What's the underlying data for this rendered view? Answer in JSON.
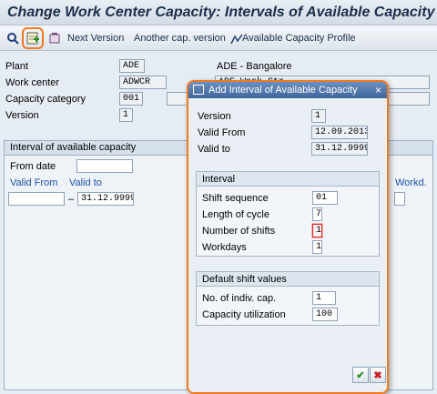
{
  "title": "Change Work Center Capacity: Intervals of Available Capacity",
  "toolbar": {
    "next_version": "Next Version",
    "another_version": "Another cap. version",
    "available_capacity_profile": "Available Capacity Profile"
  },
  "header": {
    "plant_label": "Plant",
    "plant_value": "ADE",
    "plant_desc": "ADE - Bangalore",
    "work_center_label": "Work center",
    "work_center_value": "ADWCR",
    "work_center_desc": "ADE Work Ctr",
    "capacity_category_label": "Capacity category",
    "capacity_category_value": "001",
    "version_label": "Version",
    "version_value": "1"
  },
  "interval_group": {
    "title": "Interval of available capacity",
    "from_date_label": "From date",
    "valid_from_col": "Valid From",
    "valid_to_col": "Valid to",
    "workdays_col": "Workd.",
    "row_valid_from": "",
    "row_dash": "–",
    "row_valid_to": "31.12.9999"
  },
  "dialog": {
    "title": "Add Interval of Available Capacity",
    "close": "×",
    "version_label": "Version",
    "version_value": "1",
    "valid_from_label": "Valid From",
    "valid_from_value": "12.09.2013",
    "valid_to_label": "Valid to",
    "valid_to_value": "31.12.9999",
    "interval_head": "Interval",
    "shift_sequence_label": "Shift sequence",
    "shift_sequence_value": "01",
    "length_of_cycle_label": "Length of cycle",
    "length_of_cycle_value": "7",
    "number_of_shifts_label": "Number of shifts",
    "number_of_shifts_value": "1",
    "workdays_label": "Workdays",
    "workdays_value": "1",
    "default_head": "Default shift values",
    "indiv_cap_label": "No. of indiv. cap.",
    "indiv_cap_value": "1",
    "capacity_util_label": "Capacity utilization",
    "capacity_util_value": "100",
    "ok_glyph": "✔",
    "cancel_glyph": "✖"
  },
  "colors": {
    "highlight": "#f07a1e",
    "title_bar": "#3f669d",
    "ok": "#2a8a1e",
    "cancel": "#c81e1e"
  }
}
